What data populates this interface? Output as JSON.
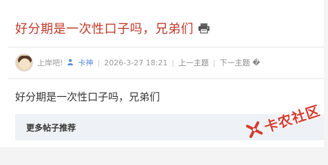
{
  "thread": {
    "title": "好分期是一次性口子吗，兄弟们",
    "print_icon": "print-icon"
  },
  "meta": {
    "author": "上岸吧!",
    "role_icon": "user-badge-icon",
    "role": "卡神",
    "date": "2026-3-27 18:21",
    "prev_topic": "上一主题",
    "next_topic": "下一主题 �"
  },
  "post": {
    "body": "好分期是一次性口子吗，兄弟们"
  },
  "more": {
    "title": "更多帖子推荐"
  },
  "watermark": {
    "text": "卡农社区"
  },
  "colors": {
    "title": "#c0392b",
    "role": "#5b8dd6",
    "watermark": "#d63a2f",
    "more_box_bg": "#eef1f5"
  }
}
